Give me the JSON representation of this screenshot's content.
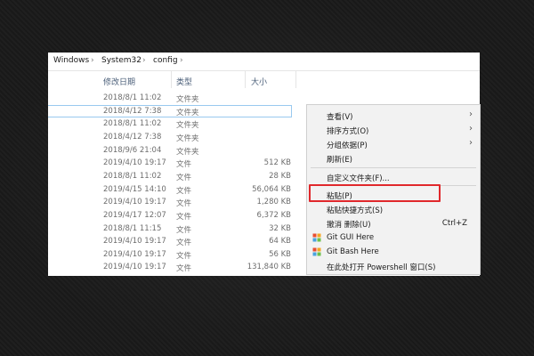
{
  "breadcrumb": [
    "Windows",
    "System32",
    "config"
  ],
  "breadcrumb_separator": "›",
  "columns": {
    "date": "修改日期",
    "type": "类型",
    "size": "大小"
  },
  "files": [
    {
      "date": "2018/8/1 11:02",
      "type": "文件夹",
      "size": ""
    },
    {
      "date": "2018/4/12 7:38",
      "type": "文件夹",
      "size": "",
      "selected": true
    },
    {
      "date": "2018/8/1 11:02",
      "type": "文件夹",
      "size": ""
    },
    {
      "date": "2018/4/12 7:38",
      "type": "文件夹",
      "size": ""
    },
    {
      "date": "2018/9/6 21:04",
      "type": "文件夹",
      "size": ""
    },
    {
      "date": "2019/4/10 19:17",
      "type": "文件",
      "size": "512 KB"
    },
    {
      "date": "2018/8/1 11:02",
      "type": "文件",
      "size": "28 KB"
    },
    {
      "date": "2019/4/15 14:10",
      "type": "文件",
      "size": "56,064 KB"
    },
    {
      "date": "2019/4/10 19:17",
      "type": "文件",
      "size": "1,280 KB"
    },
    {
      "date": "2019/4/17 12:07",
      "type": "文件",
      "size": "6,372 KB"
    },
    {
      "date": "2018/8/1 11:15",
      "type": "文件",
      "size": "32 KB"
    },
    {
      "date": "2019/4/10 19:17",
      "type": "文件",
      "size": "64 KB"
    },
    {
      "date": "2019/4/10 19:17",
      "type": "文件",
      "size": "56 KB"
    },
    {
      "date": "2019/4/10 19:17",
      "type": "文件",
      "size": "131,840 KB"
    }
  ],
  "context_menu": {
    "view": "查看(V)",
    "sort_by": "排序方式(O)",
    "group_by": "分组依据(P)",
    "refresh": "刷新(E)",
    "customize_folder": "自定义文件夹(F)...",
    "paste": "粘贴(P)",
    "paste_shortcut": "粘贴快捷方式(S)",
    "undo_delete": "撤消 删除(U)",
    "undo_shortcut": "Ctrl+Z",
    "git_gui": "Git GUI Here",
    "git_bash": "Git Bash Here",
    "powershell": "在此处打开 Powershell 窗口(S)",
    "submenu_arrow": "›"
  },
  "colors": {
    "highlight_border": "#e0282c",
    "selection_border": "#99c9ef",
    "menu_background": "#f2f2f2"
  }
}
